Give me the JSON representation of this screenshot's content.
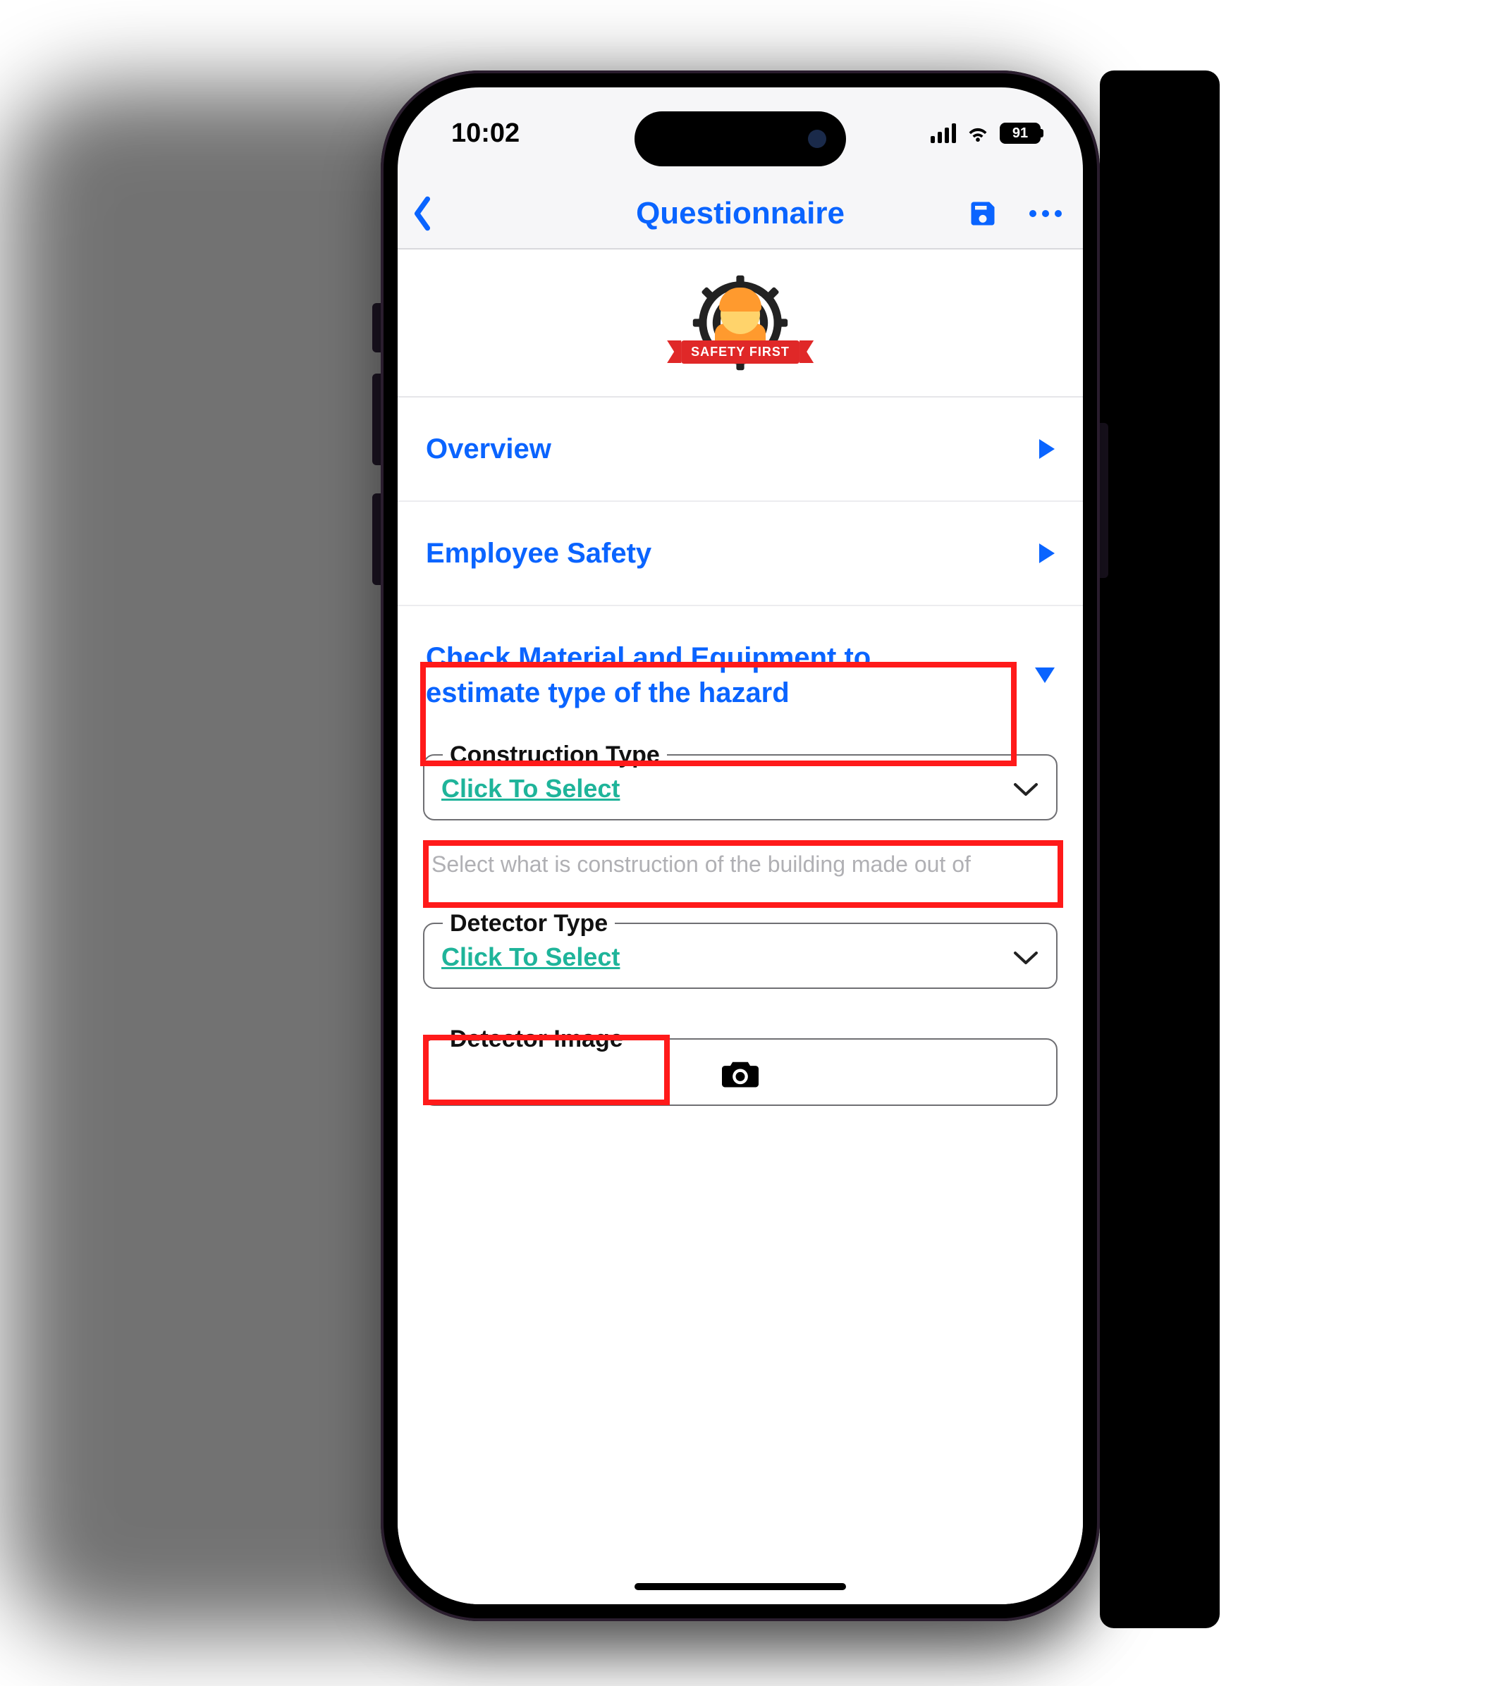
{
  "status_bar": {
    "time": "10:02",
    "battery_percent": "91"
  },
  "nav": {
    "title": "Questionnaire"
  },
  "logo": {
    "ribbon_text": "SAFETY FIRST"
  },
  "sections": {
    "overview": {
      "title": "Overview",
      "expanded": false
    },
    "employee_safety": {
      "title": "Employee Safety",
      "expanded": false
    },
    "material": {
      "title": "Check Material and Equipment to estimate type of the hazard",
      "expanded": true,
      "fields": {
        "construction_type": {
          "legend": "Construction Type",
          "placeholder_link": "Click To Select",
          "hint": "Select what is construction of the building made out of"
        },
        "detector_type": {
          "legend": "Detector Type",
          "placeholder_link": "Click To Select"
        },
        "detector_image": {
          "legend": "Detector Image"
        }
      }
    }
  }
}
